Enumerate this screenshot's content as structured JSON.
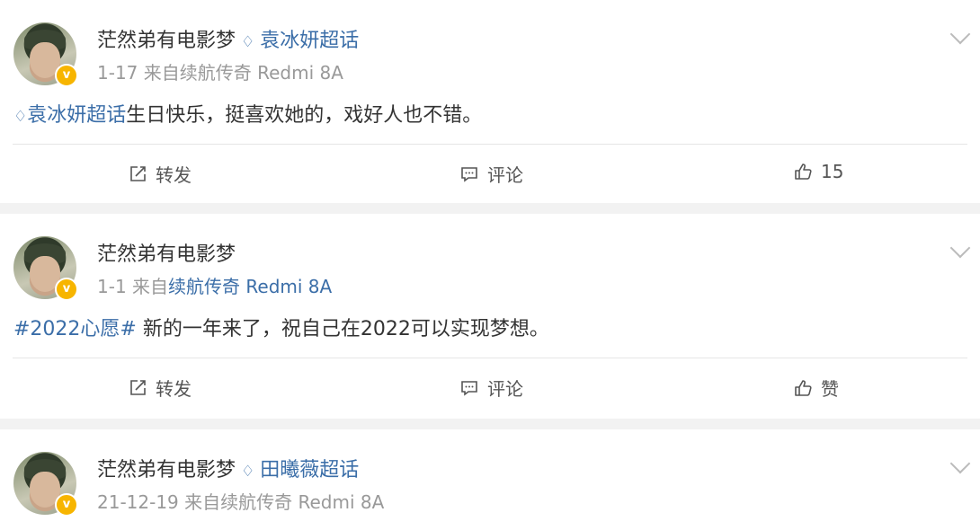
{
  "posts": [
    {
      "author": "茫然弟有电影梦",
      "topic": "袁冰妍超话",
      "date": "1-17",
      "source_prefix": "来自",
      "source": "续航传奇 Redmi 8A",
      "content_link": "袁冰妍超话",
      "content_text": "生日快乐，挺喜欢她的，戏好人也不错。",
      "repost_label": "转发",
      "comment_label": "评论",
      "like_label": "15"
    },
    {
      "author": "茫然弟有电影梦",
      "date": "1-1",
      "source_prefix": "来自",
      "source": "续航传奇 Redmi 8A",
      "content_link": "#2022心愿#",
      "content_text": " 新的一年来了，祝自己在2022可以实现梦想。",
      "repost_label": "转发",
      "comment_label": "评论",
      "like_label": "赞"
    },
    {
      "author": "茫然弟有电影梦",
      "topic": "田曦薇超话",
      "date": "21-12-19",
      "source_prefix": "来自",
      "source": "续航传奇 Redmi 8A"
    }
  ],
  "icons": {
    "verified": "verified-badge-icon",
    "diamond": "super-topic-diamond-icon",
    "repost": "repost-icon",
    "comment": "comment-icon",
    "like": "thumbs-up-icon",
    "more": "chevron-down-icon"
  },
  "colors": {
    "link": "#3b6ea8",
    "meta": "#999999",
    "verified": "#f7b500",
    "separator": "#f2f2f2"
  }
}
